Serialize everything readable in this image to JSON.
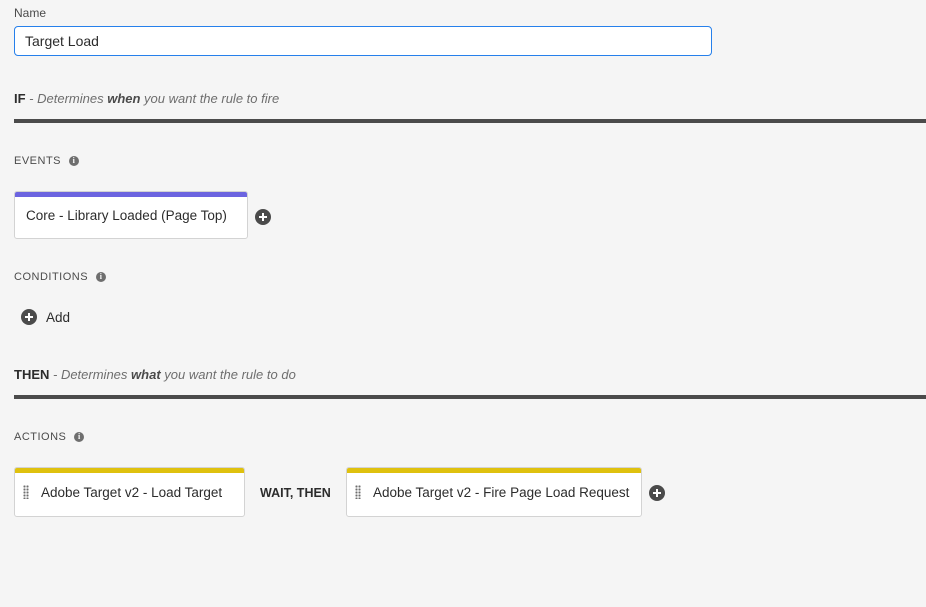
{
  "name_field": {
    "label": "Name",
    "value": "Target Load"
  },
  "if_section": {
    "keyword": "IF",
    "desc_prefix": " - Determines ",
    "desc_emphasis": "when",
    "desc_suffix": " you want the rule to fire"
  },
  "events": {
    "label": "EVENTS",
    "items": [
      {
        "label": "Core - Library Loaded (Page Top)",
        "bar_color": "#6c64e0"
      }
    ]
  },
  "conditions": {
    "label": "CONDITIONS",
    "add_label": "Add"
  },
  "then_section": {
    "keyword": "THEN",
    "desc_prefix": " - Determines ",
    "desc_emphasis": "what",
    "desc_suffix": " you want the rule to do"
  },
  "actions": {
    "label": "ACTIONS",
    "items": [
      {
        "label": "Adobe Target v2 - Load Target",
        "bar_color": "#dfc10e"
      },
      {
        "label": "Adobe Target v2 - Fire Page Load Request",
        "bar_color": "#dfc10e"
      }
    ],
    "sequence_label": "WAIT, THEN"
  },
  "colors": {
    "accent_blue": "#2680eb",
    "event_bar": "#6c64e0",
    "action_bar": "#dfc10e",
    "divider": "#4b4b4b"
  }
}
